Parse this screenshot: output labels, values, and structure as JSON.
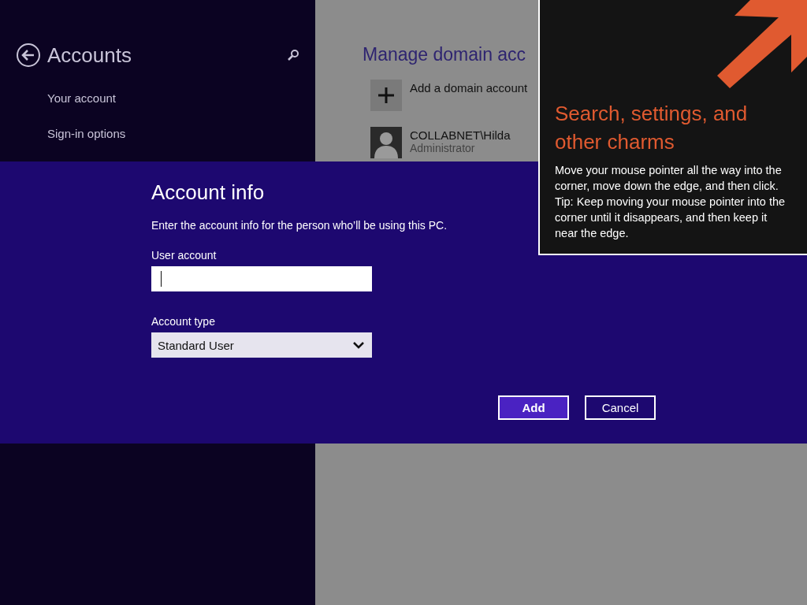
{
  "sidebar": {
    "title": "Accounts",
    "items": [
      {
        "label": "Your account",
        "selected": false
      },
      {
        "label": "Sign-in options",
        "selected": false
      }
    ]
  },
  "content": {
    "title": "Manage domain acc",
    "items": [
      {
        "kind": "add",
        "label": "Add a domain account"
      },
      {
        "kind": "user",
        "name": "COLLABNET\\Hilda",
        "role": "Administrator"
      }
    ]
  },
  "dialog": {
    "title": "Account info",
    "description": "Enter the account info for the person who’ll be using this PC.",
    "fields": [
      {
        "kind": "text",
        "label": "User account",
        "focused": true
      },
      {
        "kind": "select",
        "label": "Account type",
        "value": "Standard User"
      }
    ],
    "buttons": [
      {
        "label": "Add",
        "primary": true
      },
      {
        "label": "Cancel",
        "primary": false
      }
    ]
  },
  "tip": {
    "title": "Search, settings, and other charms",
    "body": "Move your mouse pointer all the way into the corner, move down the edge, and then click. Tip: Keep moving your mouse pointer into the corner until it disappears, and then keep it near the edge."
  }
}
